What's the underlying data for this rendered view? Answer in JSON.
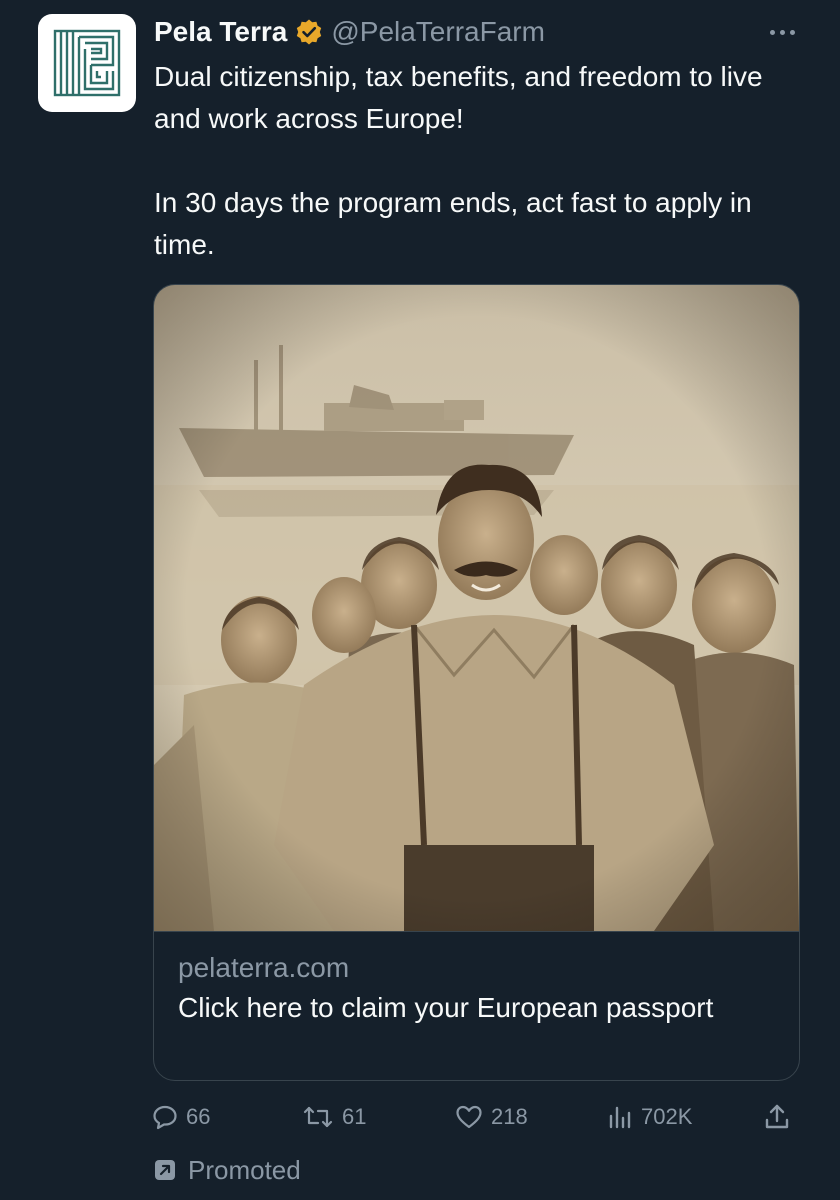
{
  "author": {
    "display_name": "Pela Terra",
    "handle": "@PelaTerraFarm",
    "verified_icon": "verified-badge-icon",
    "badge_color": "#e8a82a"
  },
  "tweet": {
    "paragraphs": [
      "Dual citizenship, tax benefits, and freedom to live and work across Europe!",
      "In 30 days the program ends, act fast to apply in time."
    ]
  },
  "link_card": {
    "domain": "pelaterra.com",
    "title": "Click here to claim your European passport",
    "image_icon": "sepia-group-photo"
  },
  "actions": {
    "replies": "66",
    "reposts": "61",
    "likes": "218",
    "views": "702K",
    "share_icon": "share-icon"
  },
  "promoted": {
    "label": "Promoted"
  },
  "colors": {
    "background": "#15202b",
    "text": "#f7f9f9",
    "secondary": "#8b98a5",
    "border": "#38444d"
  }
}
